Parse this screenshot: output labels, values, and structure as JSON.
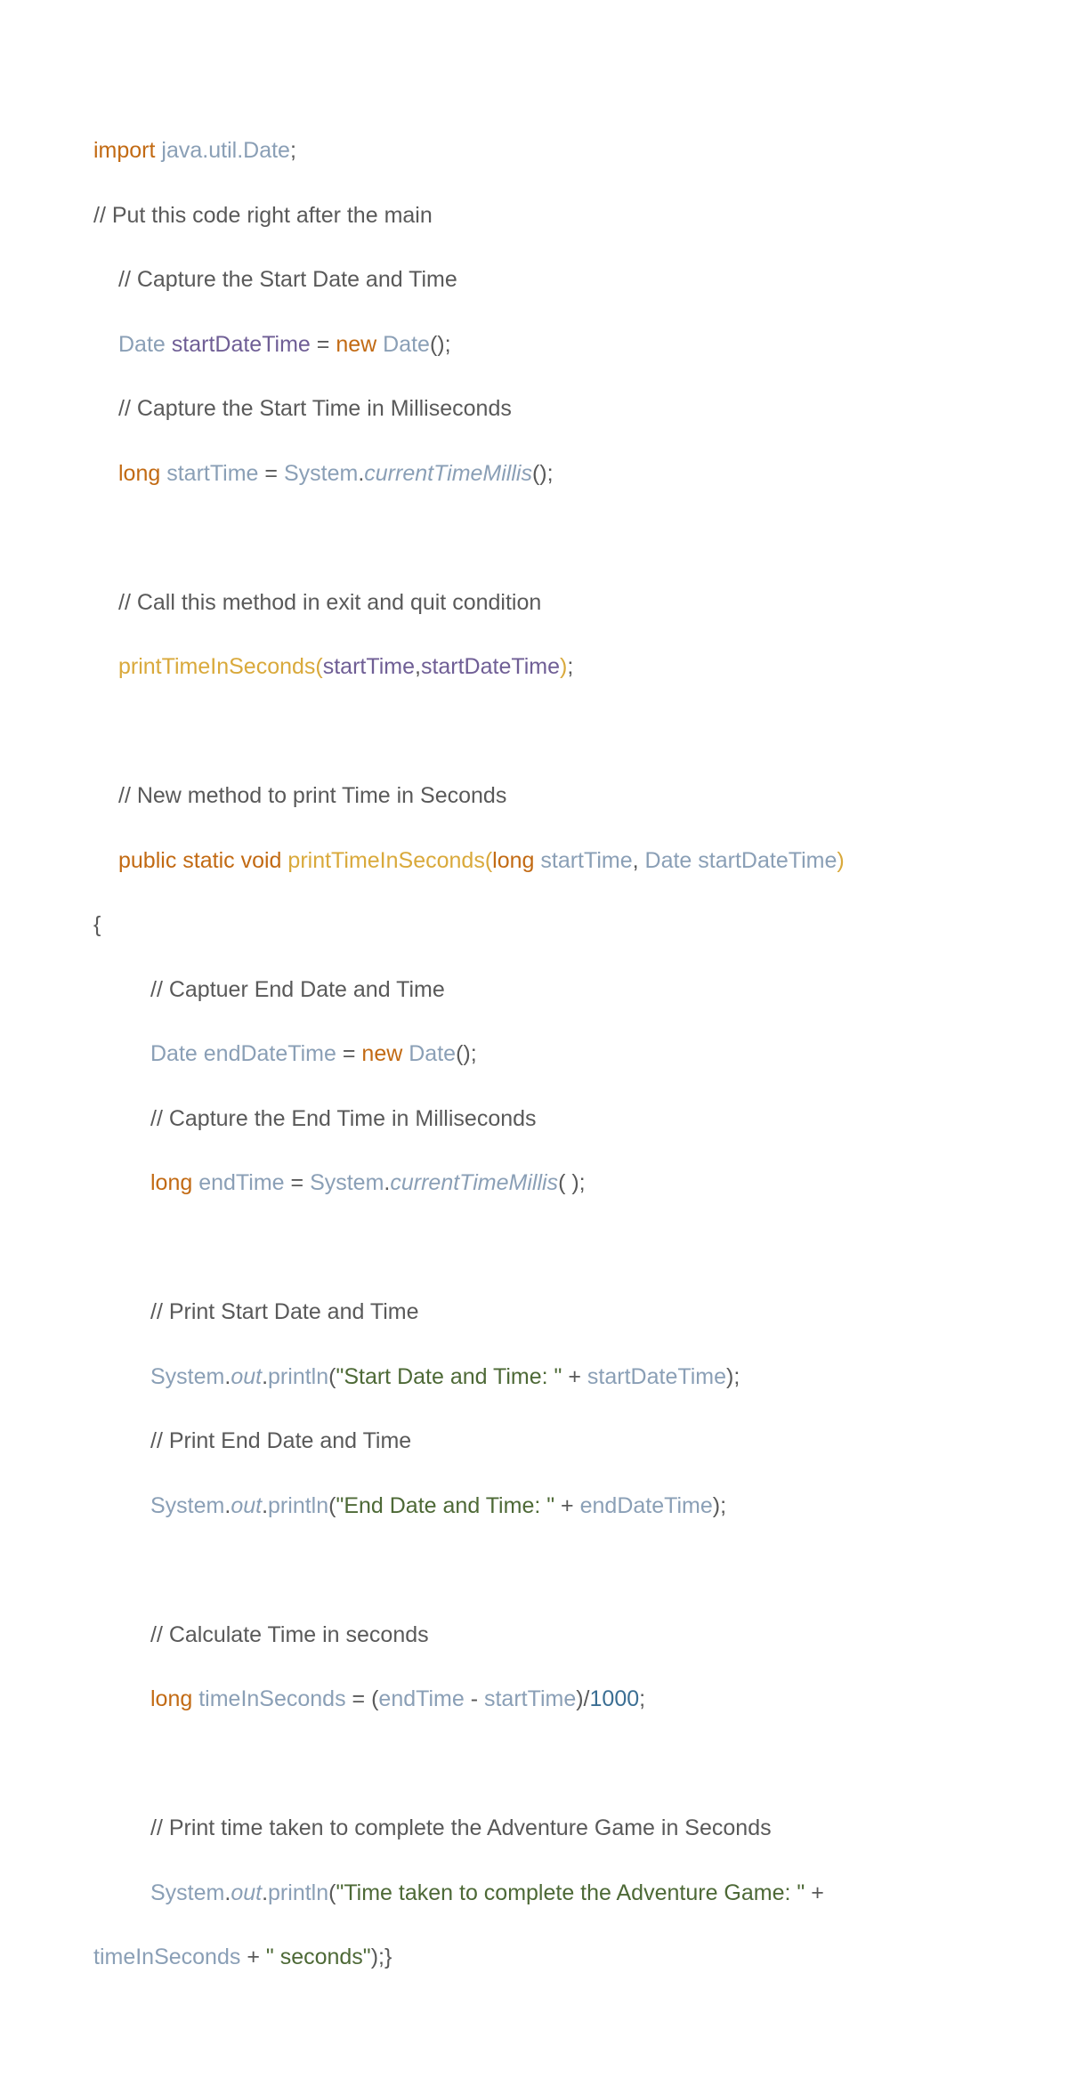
{
  "code": {
    "line1_import": "import",
    "line1_pkg": "java.util.Date",
    "line1_semi": ";",
    "line2": "// Put this code right after the main",
    "line3": "// Capture the Start Date and Time",
    "line4_type": "Date",
    "line4_var": "startDateTime",
    "line4_eq": " = ",
    "line4_new": "new",
    "line4_ctor": "Date",
    "line4_end": "();",
    "line5": "// Capture the Start Time in Milliseconds",
    "line6_long": "long",
    "line6_var": "startTime",
    "line6_eq": " = ",
    "line6_sys": "System",
    "line6_dot": ".",
    "line6_method": "currentTimeMillis",
    "line6_end": "();",
    "line7": "// Call this method in exit and quit condition",
    "line8_method": "printTimeInSeconds",
    "line8_open": "(",
    "line8_arg1": "startTime",
    "line8_comma": ",",
    "line8_arg2": "startDateTime",
    "line8_close": ")",
    "line8_semi": ";",
    "line9": "// New method to print Time in Seconds",
    "line10_public": "public",
    "line10_static": "static",
    "line10_void": "void",
    "line10_method": "printTimeInSeconds",
    "line10_open": "(",
    "line10_long": "long",
    "line10_p1": "startTime",
    "line10_comma": ", ",
    "line10_date": "Date",
    "line10_p2": "startDateTime",
    "line10_close": ")",
    "line11_brace": "{",
    "line12": "// Captuer End Date and Time",
    "line13_type": "Date",
    "line13_var": "endDateTime",
    "line13_eq": " = ",
    "line13_new": "new",
    "line13_ctor": "Date",
    "line13_end": "();",
    "line14": "// Capture the End Time in Milliseconds",
    "line15_long": "long",
    "line15_var": "endTime",
    "line15_eq": " = ",
    "line15_sys": "System",
    "line15_dot": ".",
    "line15_method": "currentTimeMillis",
    "line15_paren": "( )",
    "line15_semi": ";",
    "line16": "// Print Start Date and Time",
    "line17_sys": "System",
    "line17_dot1": ".",
    "line17_out": "out",
    "line17_dot2": ".",
    "line17_println": "println",
    "line17_open": "(",
    "line17_str": "\"Start Date and Time: \"",
    "line17_plus": " + ",
    "line17_var": "startDateTime",
    "line17_close": ")",
    "line17_semi": ";",
    "line18": "// Print End Date and Time",
    "line19_sys": "System",
    "line19_dot1": ".",
    "line19_out": "out",
    "line19_dot2": ".",
    "line19_println": "println",
    "line19_open": "(",
    "line19_str": "\"End Date and Time: \"",
    "line19_plus": " + ",
    "line19_var": "endDateTime",
    "line19_close": ")",
    "line19_semi": ";",
    "line20": "// Calculate Time in seconds",
    "line21_long": "long",
    "line21_var": "timeInSeconds",
    "line21_eq": " = (",
    "line21_e1": "endTime",
    "line21_minus": " - ",
    "line21_e2": "startTime",
    "line21_close": ")/",
    "line21_num": "1000",
    "line21_semi": ";",
    "line22": "// Print time taken to complete the Adventure Game in Seconds",
    "line23_sys": "System",
    "line23_dot1": ".",
    "line23_out": "out",
    "line23_dot2": ".",
    "line23_println": "println",
    "line23_open": "(",
    "line23_str": "\"Time taken to complete the Adventure Game: \"",
    "line23_plus": " +",
    "line24_var": "timeInSeconds",
    "line24_plus": " + ",
    "line24_str": "\" seconds\"",
    "line24_close": ")",
    "line24_semi": ";",
    "line24_brace": "}"
  }
}
